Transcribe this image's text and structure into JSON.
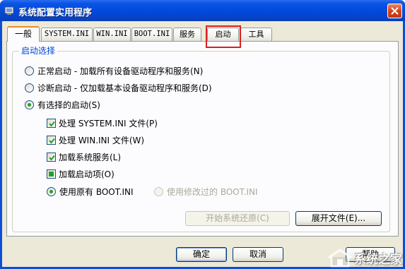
{
  "window": {
    "title": "系统配置实用程序"
  },
  "tabs": [
    {
      "label": "一般",
      "active": true
    },
    {
      "label": "SYSTEM.INI"
    },
    {
      "label": "WIN.INI"
    },
    {
      "label": "BOOT.INI"
    },
    {
      "label": "服务"
    },
    {
      "label": "启动"
    },
    {
      "label": "工具"
    }
  ],
  "group": {
    "label": "启动选择",
    "normal": "正常启动 - 加载所有设备驱动程序和服务(N)",
    "diagnostic": "诊断启动 - 仅加载基本设备驱动程序和服务(D)",
    "selective": "有选择的启动(S)",
    "process_system": "处理 SYSTEM.INI 文件(P)",
    "process_win": "处理 WIN.INI 文件(W)",
    "load_services": "加载系统服务(L)",
    "load_startup": "加载启动项(O)",
    "use_original": "使用原有 BOOT.INI",
    "use_modified": "使用修改过的 BOOT.INI"
  },
  "buttons": {
    "restore": "开始系统还原(C)",
    "expand": "展开文件(E)...",
    "ok": "确定",
    "cancel": "取消",
    "help": "帮助"
  },
  "watermark": "系统之家"
}
